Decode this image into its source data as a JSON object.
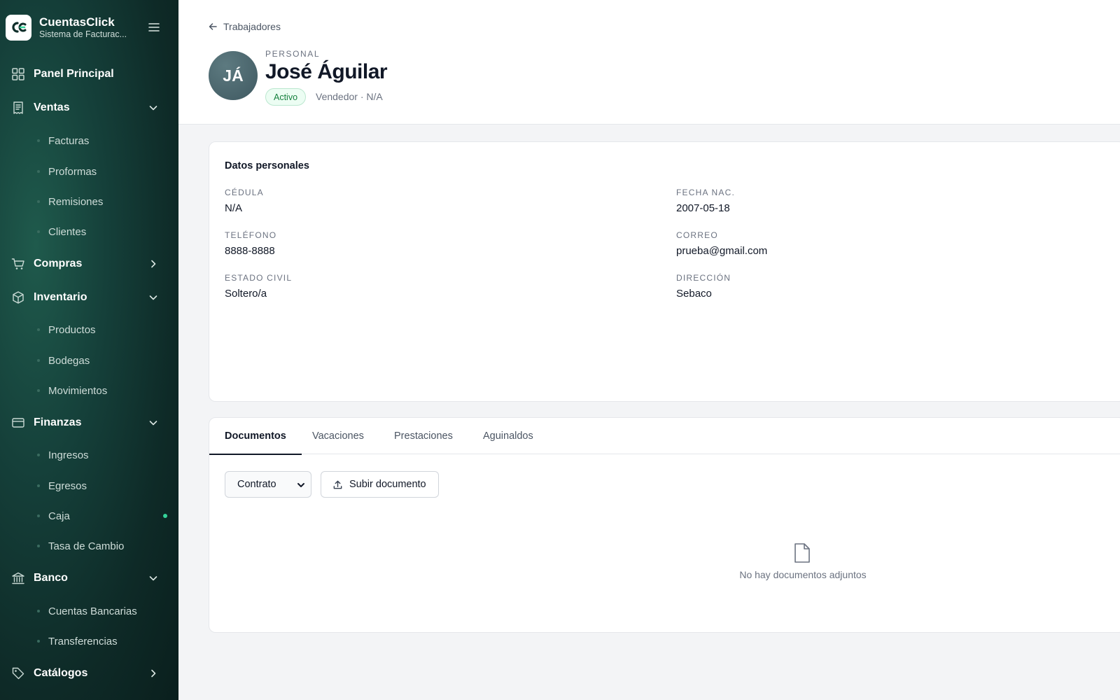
{
  "app": {
    "name": "CuentasClick",
    "subtitle": "Sistema de Facturac...",
    "logo_text": "C"
  },
  "sidebar": {
    "items": [
      {
        "label": "Panel Principal",
        "icon": "grid-icon"
      },
      {
        "label": "Ventas",
        "icon": "receipt-icon",
        "expanded": true,
        "children": [
          "Facturas",
          "Proformas",
          "Remisiones",
          "Clientes"
        ]
      },
      {
        "label": "Compras",
        "icon": "cart-icon",
        "expanded": false
      },
      {
        "label": "Inventario",
        "icon": "box-icon",
        "expanded": true,
        "children": [
          "Productos",
          "Bodegas",
          "Movimientos"
        ]
      },
      {
        "label": "Finanzas",
        "icon": "wallet-icon",
        "expanded": true,
        "children": [
          "Ingresos",
          "Egresos",
          "Caja",
          "Tasa de Cambio"
        ]
      },
      {
        "label": "Banco",
        "icon": "bank-icon",
        "expanded": true,
        "children": [
          "Cuentas Bancarias",
          "Transferencias"
        ]
      },
      {
        "label": "Catálogos",
        "icon": "tag-icon",
        "expanded": false
      }
    ]
  },
  "header": {
    "back_label": "Trabajadores",
    "kicker": "PERSONAL",
    "initials": "JÁ",
    "name": "José Águilar",
    "status": "Activo",
    "role": "Vendedor · N/A"
  },
  "personal": {
    "title": "Datos personales",
    "fields": [
      {
        "label": "CÉDULA",
        "value": "N/A"
      },
      {
        "label": "FECHA NAC.",
        "value": "2007-05-18"
      },
      {
        "label": "TELÉFONO",
        "value": "8888-8888"
      },
      {
        "label": "CORREO",
        "value": "prueba@gmail.com"
      },
      {
        "label": "ESTADO CIVIL",
        "value": "Soltero/a"
      },
      {
        "label": "DIRECCIÓN",
        "value": "Sebaco"
      }
    ]
  },
  "tabs": [
    {
      "label": "Documentos",
      "active": true
    },
    {
      "label": "Vacaciones",
      "active": false
    },
    {
      "label": "Prestaciones",
      "active": false
    },
    {
      "label": "Aguinaldos",
      "active": false
    }
  ],
  "documents": {
    "type_selected": "Contrato",
    "upload_label": "Subir documento",
    "empty_text": "No hay documentos adjuntos"
  },
  "colors": {
    "accent_green": "#34d399",
    "status_bg": "#ecfdf3",
    "status_text": "#15803d"
  }
}
